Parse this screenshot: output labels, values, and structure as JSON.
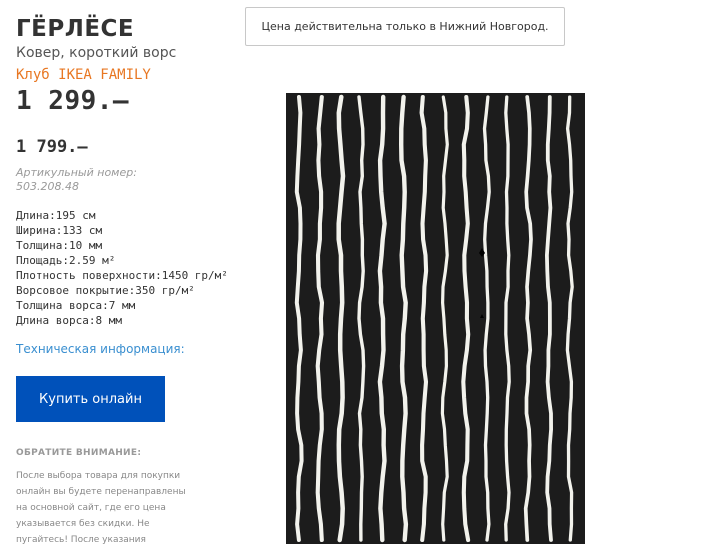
{
  "product": {
    "title": "ГЁРЛЁСЕ",
    "subtitle": "Ковер, короткий ворс",
    "family_label": "Клуб IKEA FAMILY",
    "family_price": "1 299.–",
    "regular_price": "1 799.–",
    "article": "Артикульный номер: 503.208.48"
  },
  "specs": [
    "Длина:195 см",
    "Ширина:133 см",
    "Толщина:10 мм",
    "Площадь:2.59 м²",
    "Плотность поверхности:1450 гр/м²",
    "Ворсовое покрытие:350 гр/м²",
    "Толщина ворса:7 мм",
    "Длина ворса:8 мм"
  ],
  "links": {
    "tech_info": "Техническая информация:"
  },
  "buttons": {
    "buy_online": "Купить онлайн"
  },
  "notice": {
    "heading": "ОБРАТИТЕ ВНИМАНИЕ:",
    "text": "После выбора товара для покупки онлайн вы будете перенаправлены на основной сайт, где его цена указывается без скидки. Не пугайтесь! После указания"
  },
  "banner": {
    "text": "Цена действительна только в Нижний Новгород."
  },
  "image": {
    "rug_color": "#1c1c1c",
    "stripe_color": "#f2f2ec"
  },
  "colors": {
    "family_orange": "#e87722",
    "button_blue": "#0051ba",
    "link_blue": "#3a8fd0"
  }
}
